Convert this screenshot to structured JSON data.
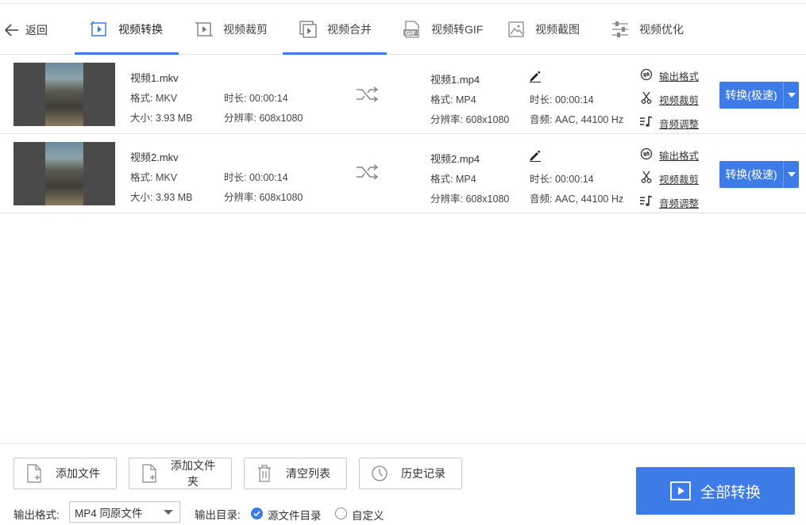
{
  "nav": {
    "back_label": "返回",
    "tabs": [
      {
        "label": "视频转换",
        "active": true
      },
      {
        "label": "视频裁剪",
        "active": false
      },
      {
        "label": "视频合并",
        "active": false
      },
      {
        "label": "视频转GIF",
        "active": false
      },
      {
        "label": "视频截图",
        "active": false
      },
      {
        "label": "视频优化",
        "active": false
      }
    ],
    "gif_badge": "GIF"
  },
  "files": [
    {
      "name": "视频1.mkv",
      "format": "格式: MKV",
      "duration": "时长: 00:00:14",
      "size": "大小: 3.93 MB",
      "resolution": "分辨率: 608x1080",
      "out_name": "视频1.mp4",
      "out_format": "格式: MP4",
      "out_duration": "时长: 00:00:14",
      "out_resolution": "分辨率: 608x1080",
      "out_audio": "音频: AAC, 44100 Hz"
    },
    {
      "name": "视频2.mkv",
      "format": "格式: MKV",
      "duration": "时长: 00:00:14",
      "size": "大小: 3.93 MB",
      "resolution": "分辨率: 608x1080",
      "out_name": "视频2.mp4",
      "out_format": "格式: MP4",
      "out_duration": "时长: 00:00:14",
      "out_resolution": "分辨率: 608x1080",
      "out_audio": "音频: AAC, 44100 Hz"
    }
  ],
  "row_actions": {
    "output_format": "输出格式",
    "video_crop": "视频裁剪",
    "audio_adjust": "音频调整",
    "convert": "转换(极速)"
  },
  "bottom": {
    "add_file": "添加文件",
    "add_folder": "添加文件夹",
    "clear_list": "清空列表",
    "history": "历史记录",
    "output_format_label": "输出格式:",
    "output_format_value": "MP4 同原文件",
    "output_dir_label": "输出目录:",
    "dir_source": "源文件目录",
    "dir_custom": "自定义",
    "convert_all": "全部转换"
  },
  "colors": {
    "accent": "#3d7be7",
    "border": "#e3e3e3"
  }
}
